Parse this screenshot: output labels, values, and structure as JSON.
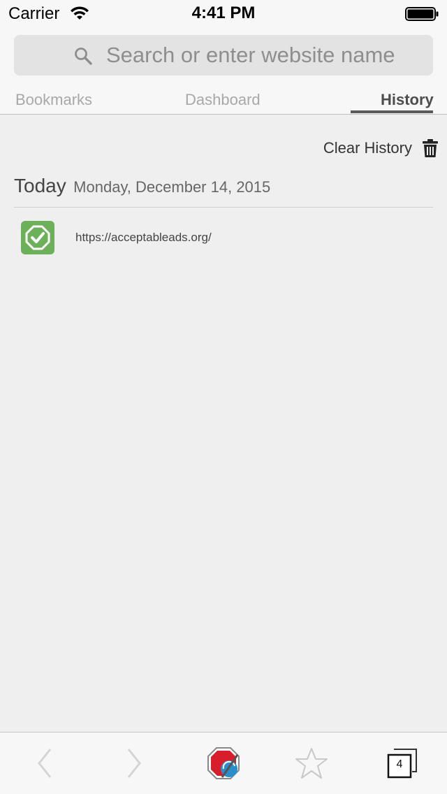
{
  "status_bar": {
    "carrier": "Carrier",
    "time": "4:41 PM"
  },
  "search": {
    "placeholder": "Search or enter website name",
    "icon": "search-icon"
  },
  "tabs": [
    {
      "label": "Bookmarks",
      "selected": false
    },
    {
      "label": "Dashboard",
      "selected": false
    },
    {
      "label": "History",
      "selected": true
    }
  ],
  "history": {
    "clear_label": "Clear History",
    "clear_icon": "trash-icon",
    "section_heading": "Today",
    "section_date": "Monday, December 14, 2015",
    "items": [
      {
        "url": "https://acceptableads.org/",
        "icon": "acceptable-ads-icon"
      }
    ]
  },
  "toolbar": {
    "tab_count": "4",
    "icons": [
      "back-icon",
      "forward-icon",
      "adblock-browser-icon",
      "star-icon",
      "tabs-icon"
    ]
  },
  "colors": {
    "accent_green": "#6db05a",
    "background": "#efefef",
    "bar_background": "#f7f7f7"
  }
}
